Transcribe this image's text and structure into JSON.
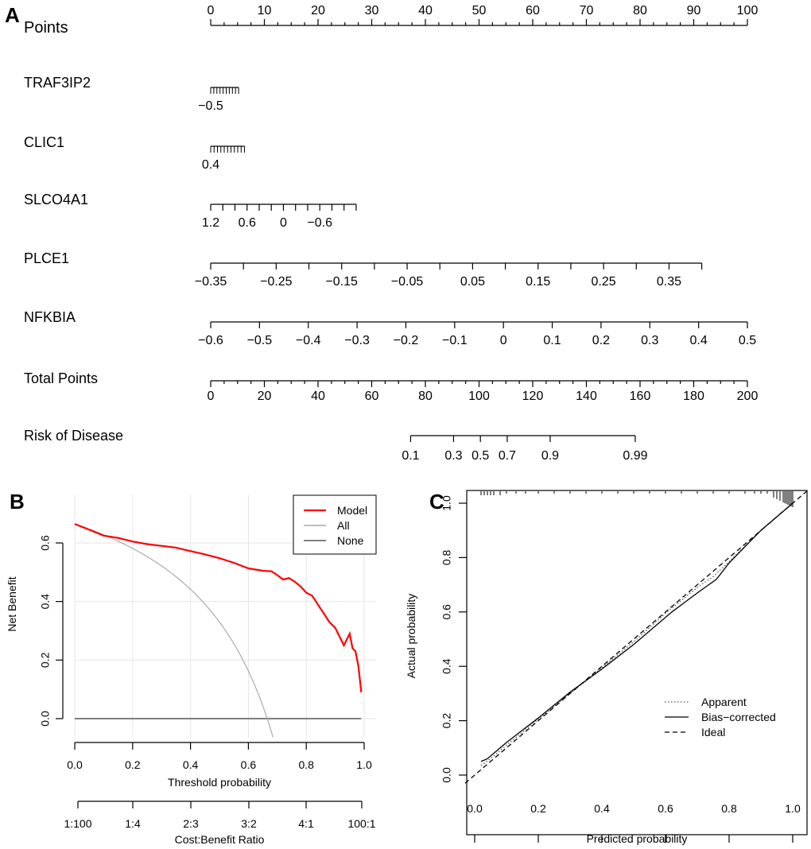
{
  "chart_data": [
    {
      "type": "nomogram",
      "panel_label": "A",
      "points_scale": {
        "label": "Points",
        "min": 0,
        "max": 100,
        "major": [
          0,
          10,
          20,
          30,
          40,
          50,
          60,
          70,
          80,
          90,
          100
        ],
        "minor_step": 2.5
      },
      "variables": [
        {
          "name": "TRAF3IP2",
          "points_range": [
            0,
            5.2
          ],
          "tick_labels": [
            "−0.5"
          ],
          "minor_ticks": 9
        },
        {
          "name": "CLIC1",
          "points_range": [
            0,
            6.3
          ],
          "tick_labels": [
            "0.4"
          ],
          "minor_ticks": 10
        },
        {
          "name": "SLCO4A1",
          "points_range": [
            0,
            27.1
          ],
          "tick_labels": [
            "1.2",
            "0.6",
            "0",
            "−0.6"
          ],
          "tick_values": [
            1.2,
            0.6,
            0,
            -0.6
          ],
          "minor_ticks": 12
        },
        {
          "name": "PLCE1",
          "points_range": [
            0,
            91.5
          ],
          "tick_labels": [
            "−0.35",
            "−0.25",
            "−0.15",
            "−0.05",
            "0.05",
            "0.15",
            "0.25",
            "0.35"
          ],
          "tick_values": [
            -0.35,
            -0.3,
            -0.25,
            -0.2,
            -0.15,
            -0.1,
            -0.05,
            0,
            0.05,
            0.1,
            0.15,
            0.2,
            0.25,
            0.3,
            0.35,
            0.4
          ]
        },
        {
          "name": "NFKBIA",
          "points_range": [
            0,
            100
          ],
          "tick_labels": [
            "−0.6",
            "−0.5",
            "−0.4",
            "−0.3",
            "−0.2",
            "−0.1",
            "0",
            "0.1",
            "0.2",
            "0.3",
            "0.4",
            "0.5"
          ],
          "tick_values": [
            -0.6,
            -0.5,
            -0.4,
            -0.3,
            -0.2,
            -0.1,
            0,
            0.1,
            0.2,
            0.3,
            0.4,
            0.5
          ]
        }
      ],
      "total_points": {
        "label": "Total Points",
        "min": 0,
        "max": 200,
        "major": [
          0,
          20,
          40,
          60,
          80,
          100,
          120,
          140,
          160,
          180,
          200
        ],
        "minor_step": 5
      },
      "risk": {
        "label": "Risk of Disease",
        "tick_labels": [
          "0.1",
          "0.3",
          "0.5",
          "0.7",
          "0.9",
          "0.99"
        ],
        "total_points_at": [
          74.5,
          90.5,
          100.5,
          110.5,
          126.5,
          158.2
        ]
      }
    },
    {
      "type": "line",
      "panel_label": "B",
      "title": "",
      "xlabel": "Threshold probability",
      "ylabel": "Net Benefit",
      "xlim": [
        0,
        1
      ],
      "ylim": [
        -0.1,
        0.68
      ],
      "xticks": [
        "0.0",
        "0.2",
        "0.4",
        "0.6",
        "0.8",
        "1.0"
      ],
      "yticks": [
        "0.0",
        "0.2",
        "0.4",
        "0.6"
      ],
      "grid": true,
      "legend": {
        "placement": "top-right",
        "entries": [
          "Model",
          "All",
          "None"
        ]
      },
      "secondary_axis": {
        "label": "Cost:Benefit Ratio",
        "ticks": [
          "1:100",
          "1:4",
          "2:3",
          "3:2",
          "4:1",
          "100:1"
        ]
      },
      "series": [
        {
          "name": "Model",
          "color": "#ff0000",
          "x": [
            0.0,
            0.05,
            0.1,
            0.15,
            0.2,
            0.25,
            0.3,
            0.35,
            0.4,
            0.45,
            0.5,
            0.55,
            0.6,
            0.65,
            0.68,
            0.7,
            0.72,
            0.74,
            0.76,
            0.78,
            0.8,
            0.82,
            0.84,
            0.86,
            0.88,
            0.9,
            0.92,
            0.93,
            0.945,
            0.95,
            0.96,
            0.97,
            0.98,
            0.99
          ],
          "y": [
            0.665,
            0.645,
            0.625,
            0.617,
            0.605,
            0.596,
            0.59,
            0.584,
            0.572,
            0.561,
            0.548,
            0.532,
            0.513,
            0.505,
            0.503,
            0.49,
            0.475,
            0.48,
            0.468,
            0.452,
            0.43,
            0.42,
            0.39,
            0.36,
            0.33,
            0.31,
            0.27,
            0.25,
            0.28,
            0.29,
            0.24,
            0.23,
            0.18,
            0.09
          ]
        },
        {
          "name": "All",
          "color": "#aaaaaa",
          "prevalence": 0.665
        },
        {
          "name": "None",
          "color": "#555555",
          "x": [
            0,
            1
          ],
          "y": [
            0,
            0
          ]
        }
      ]
    },
    {
      "type": "line",
      "panel_label": "C",
      "xlabel": "Predicted probability",
      "ylabel": "Actual probability",
      "xlim": [
        0,
        1
      ],
      "ylim": [
        0,
        1
      ],
      "xticks": [
        "0.0",
        "0.2",
        "0.4",
        "0.6",
        "0.8",
        "1.0"
      ],
      "yticks": [
        "0.0",
        "0.2",
        "0.4",
        "0.6",
        "0.8",
        "1.0"
      ],
      "grid": false,
      "legend": {
        "placement": "bottom-right",
        "entries": [
          "Apparent",
          "Bias−corrected",
          "Ideal"
        ]
      },
      "series": [
        {
          "name": "Apparent",
          "style": "dotted",
          "x": [
            0.02,
            0.05,
            0.1,
            0.2,
            0.3,
            0.4,
            0.5,
            0.6,
            0.7,
            0.75,
            0.8,
            0.9,
            1.0
          ],
          "y": [
            0.035,
            0.06,
            0.11,
            0.205,
            0.3,
            0.395,
            0.49,
            0.595,
            0.69,
            0.73,
            0.785,
            0.9,
            1.0
          ]
        },
        {
          "name": "Bias−corrected",
          "style": "solid",
          "x": [
            0.02,
            0.04,
            0.1,
            0.2,
            0.3,
            0.4,
            0.5,
            0.62,
            0.7,
            0.76,
            0.8,
            0.9,
            1.0
          ],
          "y": [
            0.05,
            0.06,
            0.12,
            0.21,
            0.305,
            0.39,
            0.48,
            0.6,
            0.67,
            0.72,
            0.78,
            0.9,
            1.0
          ]
        },
        {
          "name": "Ideal",
          "style": "dashed",
          "x": [
            -0.03,
            1.05
          ],
          "y": [
            -0.03,
            1.05
          ]
        }
      ],
      "rug": "distribution of predictions along top axis, dense near 1.0"
    }
  ]
}
